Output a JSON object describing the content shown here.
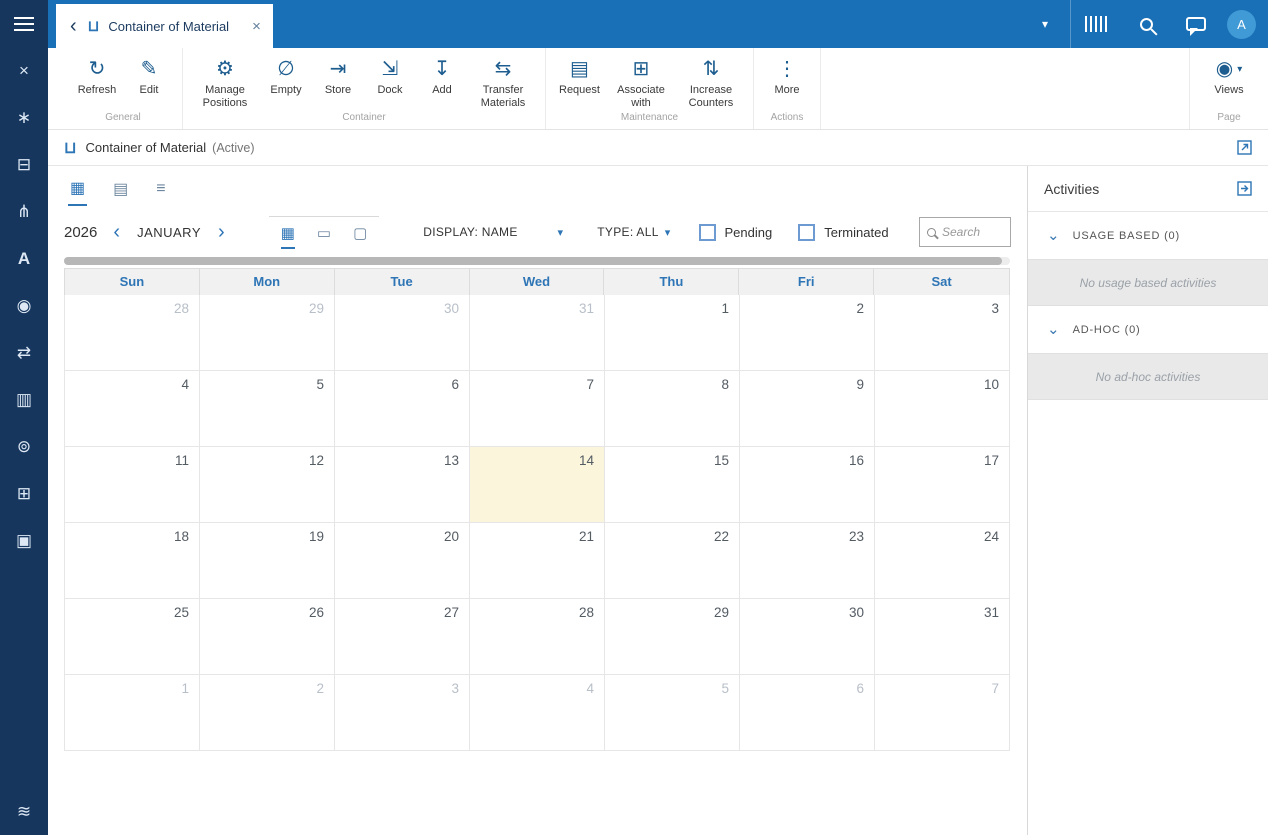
{
  "colors": {
    "accent": "#2e75b6",
    "topbar": "#1a70b6",
    "sidebar": "#16365e",
    "today_bg": "#fbf5dc"
  },
  "glyphs": {
    "caret_down": "▾",
    "chevron_left": "‹",
    "chevron_right": "›",
    "chevron_down": "⌄",
    "close": "×",
    "back": "‹",
    "container": "⊔"
  },
  "sidebar": {
    "icons": [
      {
        "name": "menu",
        "glyph": ""
      },
      {
        "name": "close",
        "glyph": "×"
      },
      {
        "name": "apps",
        "glyph": "∗"
      },
      {
        "name": "database",
        "glyph": "⊟"
      },
      {
        "name": "hierarchy",
        "glyph": "⋔"
      },
      {
        "name": "fonts",
        "glyph": "A"
      },
      {
        "name": "targets",
        "glyph": "◉"
      },
      {
        "name": "transfer",
        "glyph": "⇄"
      },
      {
        "name": "reports",
        "glyph": "▥"
      },
      {
        "name": "automation",
        "glyph": "⊚"
      },
      {
        "name": "data",
        "glyph": "⊞"
      },
      {
        "name": "window",
        "glyph": "▣"
      }
    ],
    "bottom_icon": {
      "name": "signal",
      "glyph": "≋"
    }
  },
  "topbar": {
    "tab": {
      "title": "Container of Material"
    },
    "right_icons": [
      "dropdown-caret",
      "barcode",
      "search",
      "chat"
    ],
    "avatar": "A"
  },
  "ribbon": {
    "groups": [
      {
        "label": "General",
        "buttons": [
          {
            "label": "Refresh",
            "icon": "refresh",
            "glyph": "↻"
          },
          {
            "label": "Edit",
            "icon": "pencil",
            "glyph": "✎"
          }
        ]
      },
      {
        "label": "Container",
        "buttons": [
          {
            "label": "Manage Positions",
            "icon": "gears",
            "glyph": "⚙"
          },
          {
            "label": "Empty",
            "icon": "empty-slash",
            "glyph": "∅"
          },
          {
            "label": "Store",
            "icon": "store-arrow",
            "glyph": "⇥"
          },
          {
            "label": "Dock",
            "icon": "dock-arrow",
            "glyph": "⇲"
          },
          {
            "label": "Add",
            "icon": "add-download",
            "glyph": "↧"
          },
          {
            "label": "Transfer Materials",
            "icon": "transfer-doc",
            "glyph": "⇆"
          }
        ]
      },
      {
        "label": "Maintenance",
        "buttons": [
          {
            "label": "Request",
            "icon": "request-doc",
            "glyph": "▤"
          },
          {
            "label": "Associate with",
            "icon": "associate",
            "glyph": "⊞"
          },
          {
            "label": "Increase Counters",
            "icon": "increase-counters",
            "glyph": "⇅"
          }
        ]
      },
      {
        "label": "Actions",
        "buttons": [
          {
            "label": "More",
            "icon": "more-dots",
            "glyph": "⋮"
          }
        ]
      }
    ],
    "page_group": {
      "label": "Page",
      "button": {
        "label": "Views",
        "icon": "views-eye",
        "glyph": "◉"
      }
    }
  },
  "titlebar": {
    "title": "Container of Material",
    "status": "(Active)"
  },
  "view_tabs": [
    {
      "name": "calendar-view",
      "glyph": "▦",
      "active": true
    },
    {
      "name": "agenda-view",
      "glyph": "▤",
      "active": false
    },
    {
      "name": "list-view",
      "glyph": "≡",
      "active": false
    }
  ],
  "calendar": {
    "year": "2026",
    "month": "JANUARY",
    "mode_icons": [
      {
        "name": "month",
        "glyph": "▦",
        "active": true
      },
      {
        "name": "week",
        "glyph": "▭",
        "active": false
      },
      {
        "name": "day",
        "glyph": "▢",
        "active": false
      }
    ],
    "display_filter": "DISPLAY: NAME",
    "type_filter": "TYPE: ALL",
    "checkboxes": [
      {
        "label": "Pending",
        "checked": false
      },
      {
        "label": "Terminated",
        "checked": false
      }
    ],
    "search_placeholder": "Search",
    "day_headers": [
      "Sun",
      "Mon",
      "Tue",
      "Wed",
      "Thu",
      "Fri",
      "Sat"
    ],
    "weeks": [
      [
        {
          "d": "28",
          "out": true
        },
        {
          "d": "29",
          "out": true
        },
        {
          "d": "30",
          "out": true
        },
        {
          "d": "31",
          "out": true
        },
        {
          "d": "1"
        },
        {
          "d": "2"
        },
        {
          "d": "3"
        }
      ],
      [
        {
          "d": "4"
        },
        {
          "d": "5"
        },
        {
          "d": "6"
        },
        {
          "d": "7"
        },
        {
          "d": "8"
        },
        {
          "d": "9"
        },
        {
          "d": "10"
        }
      ],
      [
        {
          "d": "11"
        },
        {
          "d": "12"
        },
        {
          "d": "13"
        },
        {
          "d": "14",
          "today": true
        },
        {
          "d": "15"
        },
        {
          "d": "16"
        },
        {
          "d": "17"
        }
      ],
      [
        {
          "d": "18"
        },
        {
          "d": "19"
        },
        {
          "d": "20"
        },
        {
          "d": "21"
        },
        {
          "d": "22"
        },
        {
          "d": "23"
        },
        {
          "d": "24"
        }
      ],
      [
        {
          "d": "25"
        },
        {
          "d": "26"
        },
        {
          "d": "27"
        },
        {
          "d": "28"
        },
        {
          "d": "29"
        },
        {
          "d": "30"
        },
        {
          "d": "31"
        }
      ],
      [
        {
          "d": "1",
          "out": true
        },
        {
          "d": "2",
          "out": true
        },
        {
          "d": "3",
          "out": true
        },
        {
          "d": "4",
          "out": true
        },
        {
          "d": "5",
          "out": true
        },
        {
          "d": "6",
          "out": true
        },
        {
          "d": "7",
          "out": true
        }
      ]
    ]
  },
  "activities": {
    "title": "Activities",
    "sections": [
      {
        "label": "USAGE BASED (0)",
        "empty_text": "No usage based activities"
      },
      {
        "label": "AD-HOC (0)",
        "empty_text": "No ad-hoc activities"
      }
    ]
  }
}
